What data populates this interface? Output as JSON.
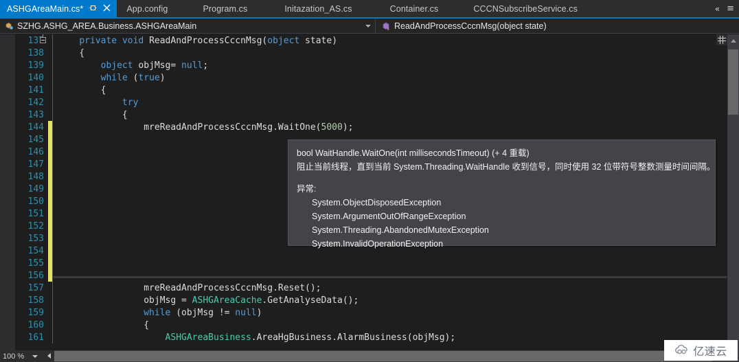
{
  "window": {
    "theme": "dark",
    "accent_color": "#007acc",
    "editor_bg": "#1e1e1e",
    "tooltip_bg": "#434349"
  },
  "tabs": [
    {
      "label": "ASHGAreaMain.cs*",
      "active": true,
      "pin_icon": "pin-icon",
      "close_icon": "close-icon"
    },
    {
      "label": "App.config",
      "active": false
    },
    {
      "label": "Program.cs",
      "active": false
    },
    {
      "label": "Initazation_AS.cs",
      "active": false
    },
    {
      "label": "Container.cs",
      "active": false
    },
    {
      "label": "CCCNSubscribeService.cs",
      "active": false
    }
  ],
  "tabstrip_right": {
    "overflow_icon": "chevron-double-left-icon",
    "overflow_label": "«",
    "tab_list_icon": "tab-list-icon",
    "tab_list_label": "≡"
  },
  "navbar": {
    "type_icon": "class-icon",
    "type_value": "SZHG.ASHG_AREA.Business.ASHGAreaMain",
    "member_icon": "method-icon",
    "member_value": "ReadAndProcessCccnMsg(object state)",
    "dropdown_icon": "chevron-down-icon"
  },
  "editor": {
    "lines": [
      {
        "no": "137",
        "modified": false,
        "collapse": true,
        "tokens": [
          {
            "t": "    ",
            "c": "p"
          },
          {
            "t": "private",
            "c": "k"
          },
          {
            "t": " ",
            "c": "p"
          },
          {
            "t": "void",
            "c": "k"
          },
          {
            "t": " ReadAndProcessCccnMsg(",
            "c": "p"
          },
          {
            "t": "object",
            "c": "k"
          },
          {
            "t": " state)",
            "c": "p"
          }
        ]
      },
      {
        "no": "138",
        "modified": false,
        "tokens": [
          {
            "t": "    {",
            "c": "p"
          }
        ]
      },
      {
        "no": "139",
        "modified": false,
        "tokens": [
          {
            "t": "        ",
            "c": "p"
          },
          {
            "t": "object",
            "c": "k"
          },
          {
            "t": " objMsg= ",
            "c": "p"
          },
          {
            "t": "null",
            "c": "k"
          },
          {
            "t": ";",
            "c": "p"
          }
        ]
      },
      {
        "no": "140",
        "modified": false,
        "tokens": [
          {
            "t": "        ",
            "c": "p"
          },
          {
            "t": "while",
            "c": "k"
          },
          {
            "t": " (",
            "c": "p"
          },
          {
            "t": "true",
            "c": "k"
          },
          {
            "t": ")",
            "c": "p"
          }
        ]
      },
      {
        "no": "141",
        "modified": false,
        "tokens": [
          {
            "t": "        {",
            "c": "p"
          }
        ]
      },
      {
        "no": "142",
        "modified": false,
        "tokens": [
          {
            "t": "            ",
            "c": "p"
          },
          {
            "t": "try",
            "c": "k"
          }
        ]
      },
      {
        "no": "143",
        "modified": false,
        "tokens": [
          {
            "t": "            {",
            "c": "p"
          }
        ]
      },
      {
        "no": "144",
        "modified": true,
        "tokens": [
          {
            "t": "                mreReadAndProcessCccnMsg.WaitOne(",
            "c": "p"
          },
          {
            "t": "5000",
            "c": "n"
          },
          {
            "t": ");",
            "c": "p"
          }
        ]
      },
      {
        "no": "145",
        "modified": true,
        "tokens": []
      },
      {
        "no": "146",
        "modified": true,
        "tokens": []
      },
      {
        "no": "147",
        "modified": true,
        "tokens": []
      },
      {
        "no": "148",
        "modified": true,
        "tokens": []
      },
      {
        "no": "149",
        "modified": true,
        "tokens": []
      },
      {
        "no": "150",
        "modified": true,
        "tokens": []
      },
      {
        "no": "151",
        "modified": true,
        "tokens": []
      },
      {
        "no": "152",
        "modified": true,
        "tokens": []
      },
      {
        "no": "153",
        "modified": true,
        "tokens": []
      },
      {
        "no": "154",
        "modified": true,
        "tokens": []
      },
      {
        "no": "155",
        "modified": true,
        "tokens": []
      },
      {
        "no": "156",
        "modified": true,
        "tokens": []
      },
      {
        "no": "157",
        "modified": false,
        "tokens": [
          {
            "t": "                mreReadAndProcessCccnMsg.Reset();",
            "c": "p"
          }
        ]
      },
      {
        "no": "158",
        "modified": false,
        "tokens": [
          {
            "t": "                objMsg = ",
            "c": "p"
          },
          {
            "t": "ASHGAreaCache",
            "c": "t"
          },
          {
            "t": ".GetAnalyseData();",
            "c": "p"
          }
        ]
      },
      {
        "no": "159",
        "modified": false,
        "tokens": [
          {
            "t": "                ",
            "c": "p"
          },
          {
            "t": "while",
            "c": "k"
          },
          {
            "t": " (objMsg != ",
            "c": "p"
          },
          {
            "t": "null",
            "c": "k"
          },
          {
            "t": ")",
            "c": "p"
          }
        ]
      },
      {
        "no": "160",
        "modified": false,
        "tokens": [
          {
            "t": "                {",
            "c": "p"
          }
        ]
      },
      {
        "no": "161",
        "modified": false,
        "tokens": [
          {
            "t": "                    ",
            "c": "p"
          },
          {
            "t": "ASHGAreaBusiness",
            "c": "t"
          },
          {
            "t": ".AreaHgBusiness.AlarmBusiness(objMsg);",
            "c": "p"
          }
        ]
      }
    ]
  },
  "tooltip": {
    "signature": "bool WaitHandle.WaitOne(int millisecondsTimeout)  (+ 4 重载)",
    "description": "阻止当前线程，直到当前 System.Threading.WaitHandle 收到信号，同时使用 32 位带符号整数测量时间间隔。",
    "exceptions_label": "异常:",
    "exceptions": [
      "System.ObjectDisposedException",
      "System.ArgumentOutOfRangeException",
      "System.Threading.AbandonedMutexException",
      "System.InvalidOperationException"
    ]
  },
  "statusbar": {
    "zoom_level": "100 %",
    "zoom_caret_icon": "chevron-down-icon",
    "hscroll_left_icon": "arrow-left-icon"
  },
  "watermark": {
    "text": "亿速云",
    "icon": "cloud-logo-icon"
  }
}
